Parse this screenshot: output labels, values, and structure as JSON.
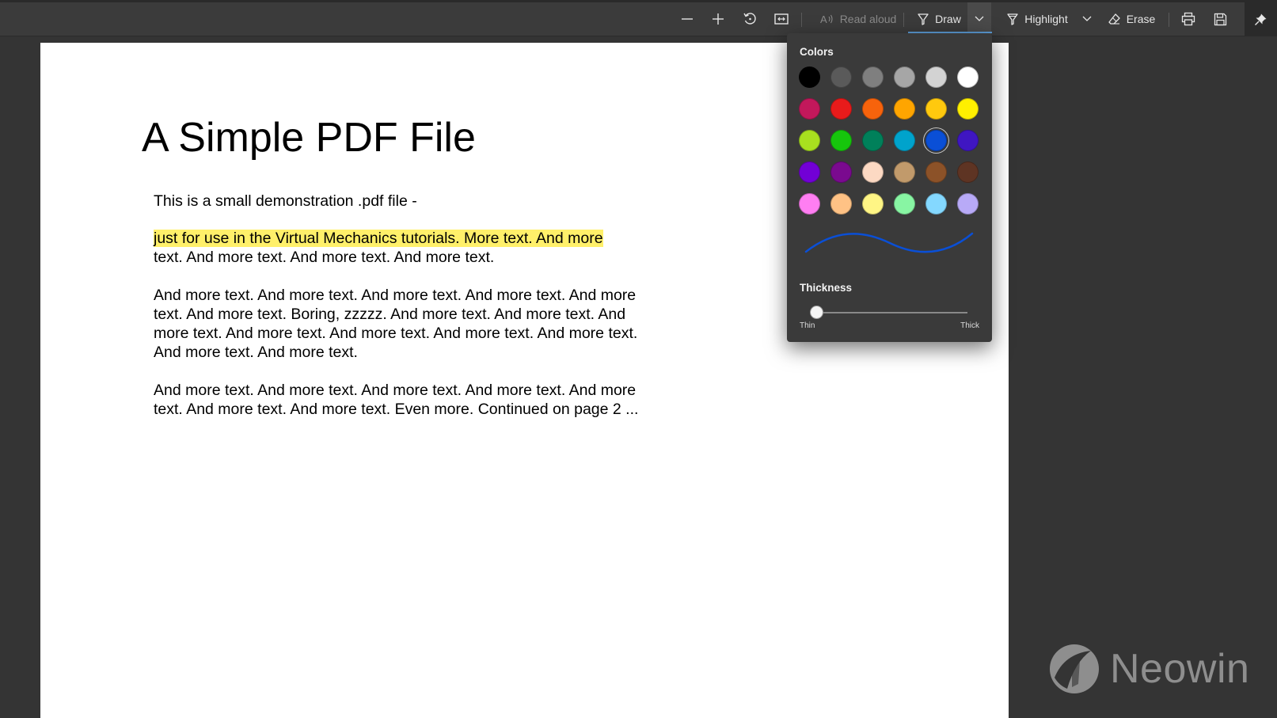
{
  "toolbar": {
    "zoom_out": "zoom-out",
    "zoom_in": "zoom-in",
    "read_aloud_label": "Read aloud",
    "draw_label": "Draw",
    "highlight_label": "Highlight",
    "erase_label": "Erase"
  },
  "document": {
    "title": "A Simple PDF File",
    "p1": "This is a small demonstration .pdf file -",
    "p2_highlighted": "just for use in the Virtual Mechanics tutorials. More text. And more",
    "p2_rest": "text. And more text. And more text. And more text.",
    "p3": [
      "And more text. And more text. And more text. And more text. And more",
      "text. And more text. Boring, zzzzz. And more text. And more text. And",
      "more text. And more text. And more text. And more text. And more text.",
      "And more text. And more text."
    ],
    "p4": [
      "And more text. And more text. And more text. And more text. And more",
      "text. And more text. And more text. Even more. Continued on page 2 ..."
    ],
    "highlight_color": "#fff06a"
  },
  "draw_panel": {
    "colors_heading": "Colors",
    "thickness_heading": "Thickness",
    "thin_label": "Thin",
    "thick_label": "Thick",
    "thickness_value": 0.03,
    "selected_color": "#0a4fd6",
    "colors": [
      [
        "#000000",
        "#5a5a5a",
        "#7f7f7f",
        "#a6a6a6",
        "#d3d3d3",
        "#ffffff"
      ],
      [
        "#c2185b",
        "#e81b1b",
        "#f7630c",
        "#ffa500",
        "#ffc90e",
        "#fff000"
      ],
      [
        "#a8e01f",
        "#16c60c",
        "#00805a",
        "#00a3cc",
        "#0a4fd6",
        "#3f16c2"
      ],
      [
        "#7200d6",
        "#7a0a8f",
        "#fcd9c3",
        "#c19a6b",
        "#8c5228",
        "#5e3423"
      ],
      [
        "#ff7ef2",
        "#ffc285",
        "#fff585",
        "#88f5a3",
        "#84d8ff",
        "#b8aaf7"
      ]
    ]
  },
  "watermark": {
    "text": "Neowin"
  }
}
